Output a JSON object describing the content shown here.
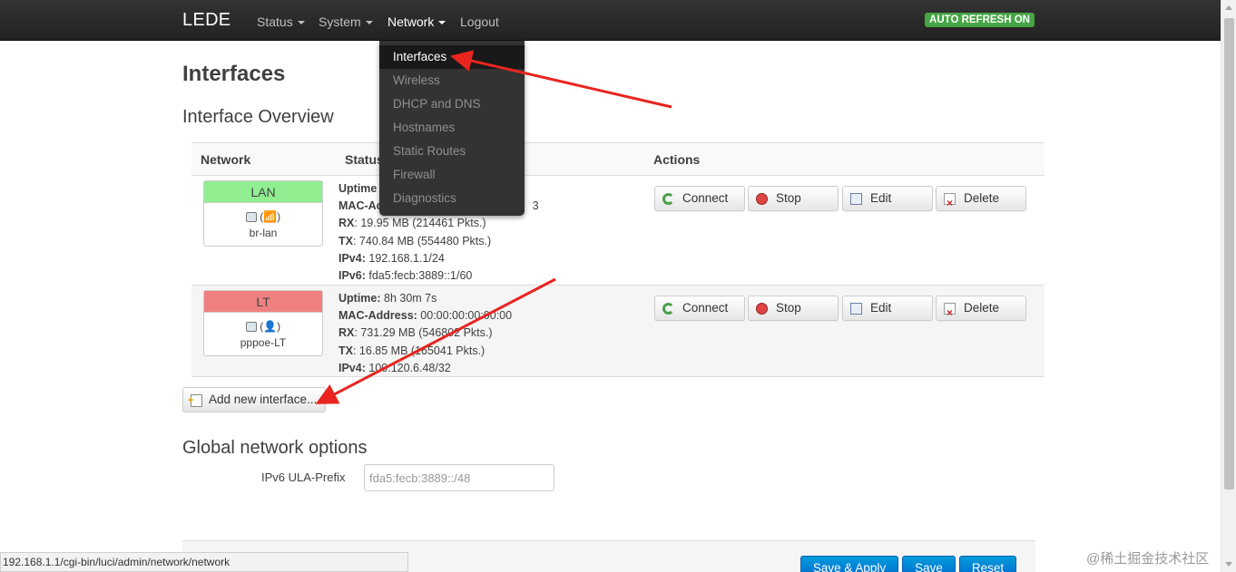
{
  "navbar": {
    "brand": "LEDE",
    "menus": [
      "Status",
      "System",
      "Network",
      "Logout"
    ],
    "auto_refresh": "AUTO REFRESH ON"
  },
  "network_menu": {
    "items": [
      "Interfaces",
      "Wireless",
      "DHCP and DNS",
      "Hostnames",
      "Static Routes",
      "Firewall",
      "Diagnostics"
    ],
    "active": "Interfaces"
  },
  "page": {
    "title": "Interfaces",
    "overview_heading": "Interface Overview",
    "global_heading": "Global network options"
  },
  "table": {
    "headers": {
      "network": "Network",
      "status": "Status",
      "actions": "Actions"
    },
    "buttons": {
      "connect": "Connect",
      "stop": "Stop",
      "edit": "Edit",
      "delete": "Delete"
    },
    "rows": [
      {
        "name": "LAN",
        "header_color": "#90ee90",
        "icons": "(📶)",
        "ifname": "br-lan",
        "lines": [
          {
            "label": "Uptime",
            "value": ""
          },
          {
            "label": "MAC-Ac",
            "value": "3"
          },
          {
            "label": "RX",
            "value": ": 19.95 MB (214461 Pkts.)"
          },
          {
            "label": "TX",
            "value": ": 740.84 MB (554480 Pkts.)"
          },
          {
            "label": "IPv4:",
            "value": " 192.168.1.1/24"
          },
          {
            "label": "IPv6:",
            "value": " fda5:fecb:3889::1/60"
          }
        ]
      },
      {
        "name": "LT",
        "header_color": "#f08080",
        "icons": "(👤)",
        "ifname": "pppoe-LT",
        "lines": [
          {
            "label": "Uptime:",
            "value": " 8h 30m 7s"
          },
          {
            "label": "MAC-Address:",
            "value": " 00:00:00:00:00:00"
          },
          {
            "label": "RX",
            "value": ": 731.29 MB (546802 Pkts.)"
          },
          {
            "label": "TX",
            "value": ": 16.85 MB (165041 Pkts.)"
          },
          {
            "label": "IPv4:",
            "value": " 100.120.6.48/32"
          }
        ]
      }
    ]
  },
  "add_interface_label": "Add new interface...",
  "ula": {
    "label": "IPv6 ULA-Prefix",
    "value": "fda5:fecb:3889::/48"
  },
  "footer": {
    "save_apply": "Save & Apply",
    "save": "Save",
    "reset": "Reset"
  },
  "status_bar_url": "192.168.1.1/cgi-bin/luci/admin/network/network",
  "watermark": "@稀土掘金技术社区",
  "annotation_color": "#e8251f"
}
